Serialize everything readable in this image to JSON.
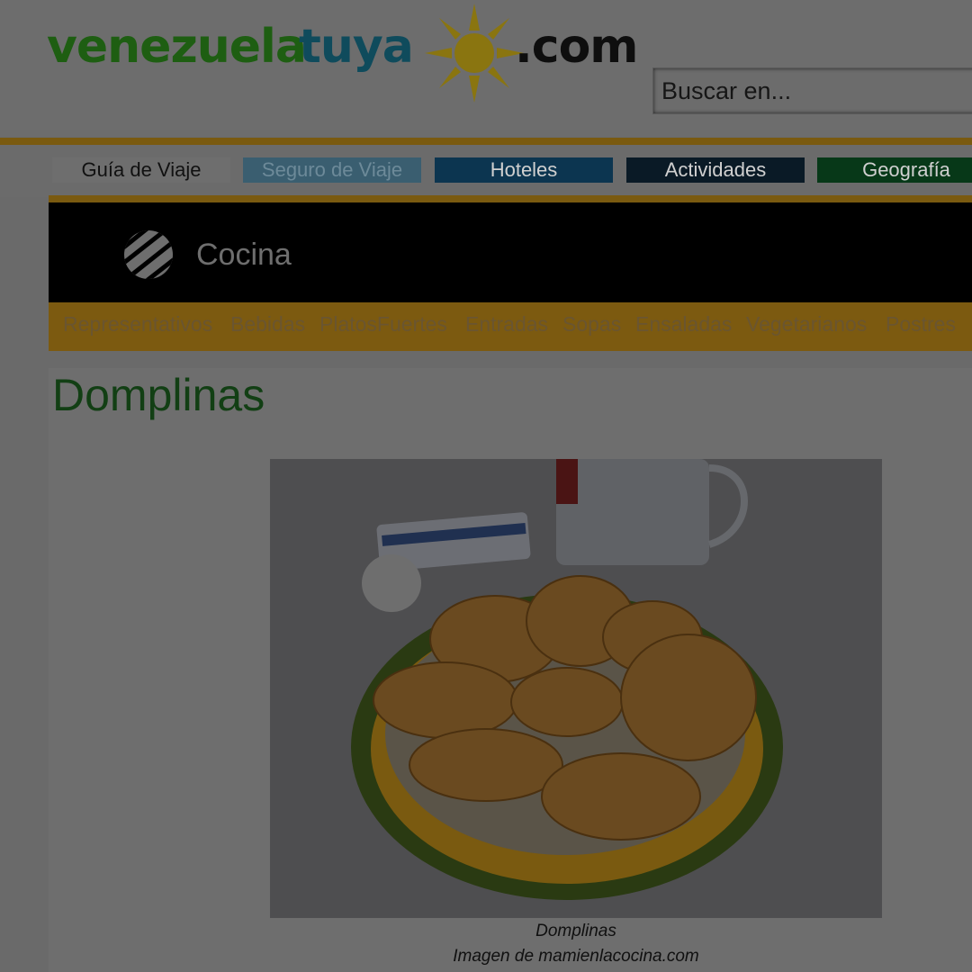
{
  "site": {
    "logo_text": [
      "venezuela",
      "tuya",
      ".com"
    ],
    "brand_colors": {
      "green": "#1e5e12",
      "blue": "#0f4b5c",
      "sun": "#8a7510"
    }
  },
  "search": {
    "placeholder": "Buscar en...",
    "value": ""
  },
  "nav": [
    {
      "label": "Guía de Viaje",
      "bg": "#6e6e6e",
      "color": "#111111"
    },
    {
      "label": "Seguro de Viaje",
      "bg": "#3a5e70",
      "color": "#6d8a99"
    },
    {
      "label": "Hoteles",
      "bg": "#0c3550",
      "color": "#d0d0d0"
    },
    {
      "label": "Actividades",
      "bg": "#0a1a26",
      "color": "#d0d0d0"
    },
    {
      "label": "Geografía",
      "bg": "#073818",
      "color": "#d0d0d0"
    }
  ],
  "category": {
    "icon": "striped-circle-icon",
    "title": "Cocina"
  },
  "subnav": [
    "Representativos",
    "Bebidas",
    "PlatosFuertes",
    "Entradas",
    "Sopas",
    "Ensaladas",
    "Vegetarianos",
    "Postres"
  ],
  "recipe": {
    "title": "Domplinas",
    "caption": "Domplinas",
    "credit": "Imagen de mamienlacocina.com"
  }
}
